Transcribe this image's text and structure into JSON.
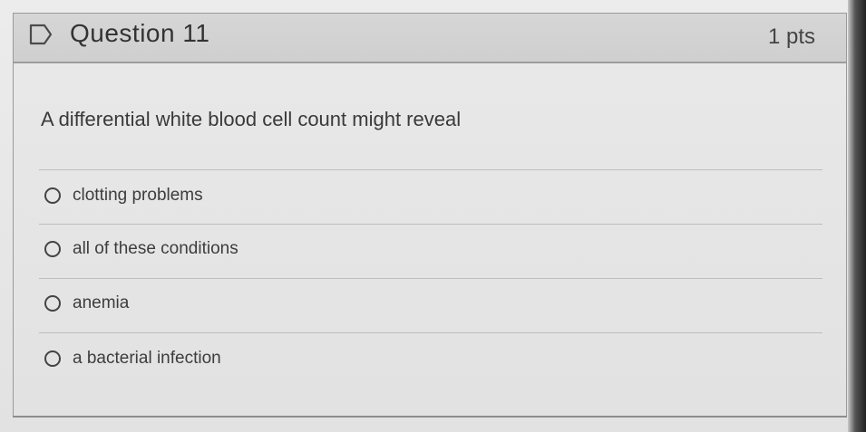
{
  "question": {
    "title": "Question 11",
    "points": "1 pts",
    "prompt": "A differential white blood cell count might reveal",
    "options": [
      {
        "label": "clotting problems"
      },
      {
        "label": "all of these conditions"
      },
      {
        "label": "anemia"
      },
      {
        "label": "a bacterial infection"
      }
    ]
  },
  "icons": {
    "flag": "flag-outline-icon",
    "radio": "radio-unselected-icon"
  }
}
